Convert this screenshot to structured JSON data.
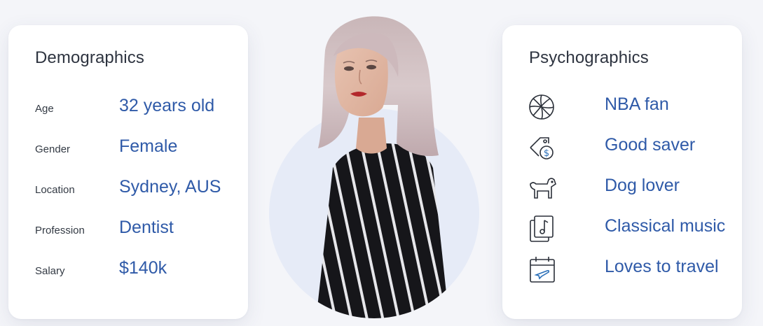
{
  "demographics": {
    "title": "Demographics",
    "rows": [
      {
        "label": "Age",
        "value": "32 years old"
      },
      {
        "label": "Gender",
        "value": "Female"
      },
      {
        "label": "Location",
        "value": "Sydney, AUS"
      },
      {
        "label": "Profession",
        "value": "Dentist"
      },
      {
        "label": "Salary",
        "value": "$140k"
      }
    ]
  },
  "psychographics": {
    "title": "Psychographics",
    "items": [
      {
        "icon": "basketball-icon",
        "value": "NBA fan"
      },
      {
        "icon": "price-tag-dollar-icon",
        "value": "Good saver"
      },
      {
        "icon": "dog-icon",
        "value": "Dog lover"
      },
      {
        "icon": "music-note-icon",
        "value": "Classical music"
      },
      {
        "icon": "calendar-plane-icon",
        "value": "Loves to travel"
      }
    ]
  },
  "colors": {
    "background": "#f4f5f9",
    "card": "#ffffff",
    "value_text": "#2f5aa8",
    "label_text": "#333a44",
    "circle": "#e6ebf7"
  }
}
